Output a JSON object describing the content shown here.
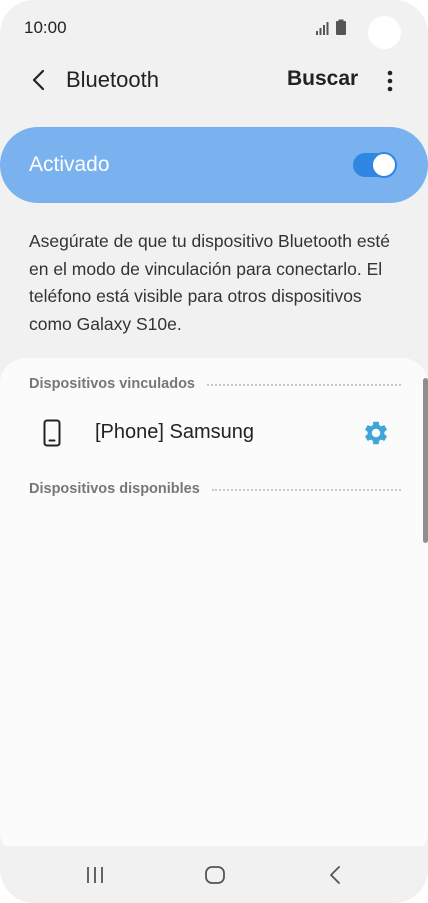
{
  "status_bar": {
    "time": "10:00"
  },
  "app_bar": {
    "title": "Bluetooth",
    "search_label": "Buscar",
    "back_icon": "chevron-left-icon",
    "more_icon": "more-vert-icon"
  },
  "master_switch": {
    "label": "Activado",
    "state": "on",
    "accent_color": "#79b2ee",
    "toggle_color": "#2f86e3"
  },
  "description": "Asegúrate de que tu dispositivo Bluetooth esté en el modo de vinculación para conectarlo. El teléfono está visible para otros dispositivos como Galaxy S10e.",
  "paired_section": {
    "title": "Dispositivos vinculados",
    "devices": [
      {
        "name": "[Phone] Samsung",
        "icon": "phone-icon",
        "settings_icon": "gear-icon",
        "settings_color": "#3ea6d9"
      }
    ]
  },
  "available_section": {
    "title": "Dispositivos disponibles"
  },
  "nav_bar": {
    "recents_icon": "recents-icon",
    "home_icon": "home-icon",
    "back_icon": "back-icon"
  }
}
